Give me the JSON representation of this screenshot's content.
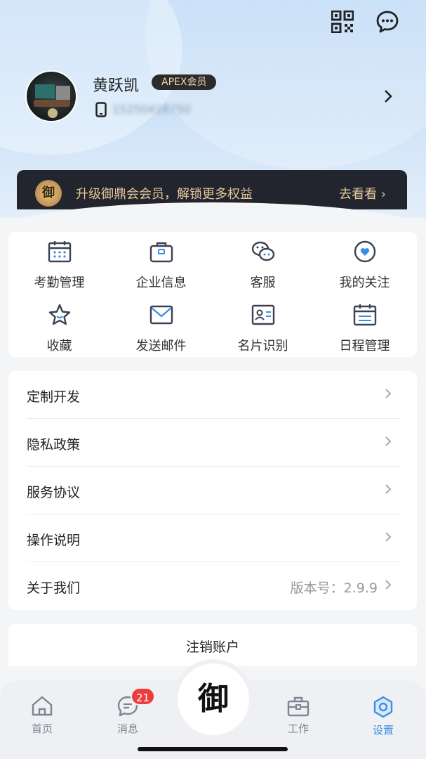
{
  "user": {
    "name": "黄跃凯",
    "membership_badge": "APEX会员",
    "phone": "15250416750"
  },
  "vip_banner": {
    "logo_char": "御",
    "text": "升级御鼎会会员，解锁更多权益",
    "action": "去看看 ›"
  },
  "grid": [
    {
      "label": "考勤管理",
      "icon": "calendar-icon"
    },
    {
      "label": "企业信息",
      "icon": "briefcase-icon"
    },
    {
      "label": "客服",
      "icon": "wechat-chat-icon"
    },
    {
      "label": "我的关注",
      "icon": "heart-circle-icon"
    },
    {
      "label": "收藏",
      "icon": "star-icon"
    },
    {
      "label": "发送邮件",
      "icon": "mail-icon"
    },
    {
      "label": "名片识别",
      "icon": "id-card-icon"
    },
    {
      "label": "日程管理",
      "icon": "schedule-icon"
    }
  ],
  "menu": [
    {
      "label": "定制开发",
      "value": ""
    },
    {
      "label": "隐私政策",
      "value": ""
    },
    {
      "label": "服务协议",
      "value": ""
    },
    {
      "label": "操作说明",
      "value": ""
    },
    {
      "label": "关于我们",
      "value": "版本号：2.9.9"
    }
  ],
  "logout_label": "注销账户",
  "tabbar": {
    "tabs": [
      {
        "label": "首页",
        "icon": "home-icon"
      },
      {
        "label": "消息",
        "icon": "message-icon",
        "badge": "21"
      },
      {
        "label": "工作",
        "icon": "toolbox-icon"
      },
      {
        "label": "设置",
        "icon": "settings-hexagon-icon",
        "active": true
      }
    ],
    "center_logo_char": "御"
  },
  "colors": {
    "accent": "#3a8ee6",
    "vip_gold": "#e6c79a",
    "vip_dark": "#22252e",
    "badge_red": "#ee3b3b"
  }
}
